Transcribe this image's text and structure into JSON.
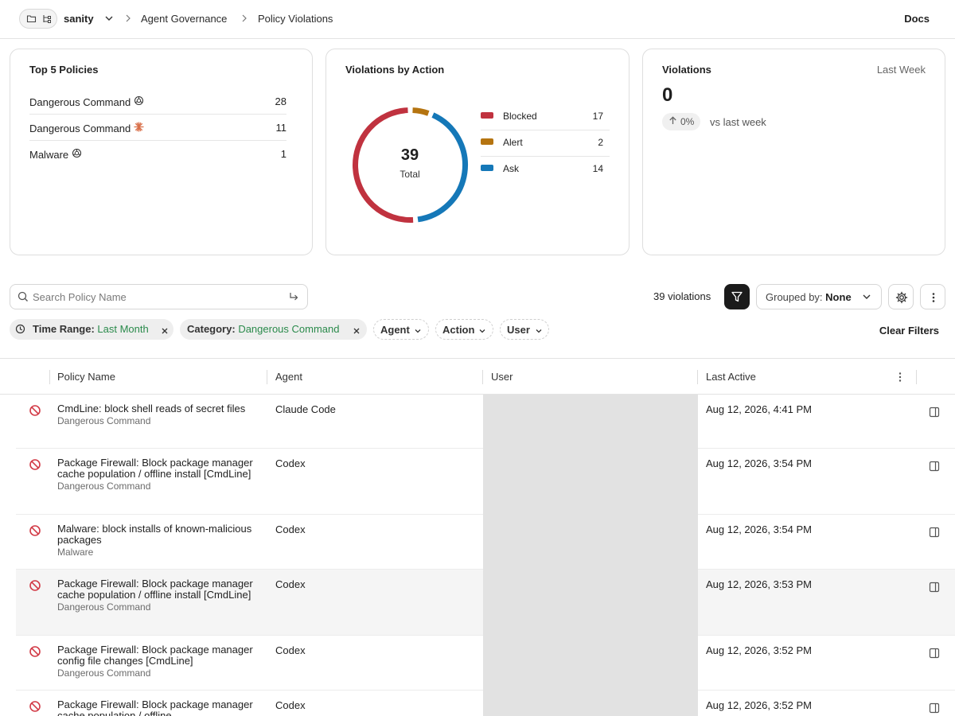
{
  "header": {
    "workspace": "sanity",
    "breadcrumbs": [
      "Agent Governance",
      "Policy Violations"
    ],
    "docs_label": "Docs"
  },
  "top_policies": {
    "title": "Top 5 Policies",
    "items": [
      {
        "name": "Dangerous Command",
        "count": "28",
        "icon": "openai-logo-icon"
      },
      {
        "name": "Dangerous Command",
        "count": "11",
        "icon": "claude-logo-icon"
      },
      {
        "name": "Malware",
        "count": "1",
        "icon": "openai-logo-icon"
      }
    ]
  },
  "violations_by_action": {
    "title": "Violations by Action",
    "total": "39",
    "total_label": "Total",
    "items": [
      {
        "label": "Blocked",
        "value": "17",
        "color": "#c0323f"
      },
      {
        "label": "Alert",
        "value": "2",
        "color": "#b57410"
      },
      {
        "label": "Ask",
        "value": "14",
        "color": "#1578b8"
      }
    ]
  },
  "violations_kpi": {
    "title": "Violations",
    "period": "Last Week",
    "value": "0",
    "delta": "0%",
    "delta_label": "vs last week"
  },
  "toolbar": {
    "search_placeholder": "Search Policy Name",
    "count_label": "39 violations",
    "grouped_prefix": "Grouped by:",
    "grouped_value": "None"
  },
  "filters": {
    "time_range_label": "Time Range:",
    "time_range_value": "Last Month",
    "category_label": "Category:",
    "category_value": "Dangerous Command",
    "agent": "Agent",
    "action": "Action",
    "user": "User",
    "clear": "Clear Filters"
  },
  "table": {
    "columns": [
      "Policy Name",
      "Agent",
      "User",
      "Last Active"
    ],
    "rows": [
      {
        "name": "CmdLine: block shell reads of secret files",
        "category": "Dangerous Command",
        "agent": "Claude Code",
        "last_active": "Aug 12, 2026, 4:41 PM"
      },
      {
        "name": "Package Firewall: Block package manager cache population / offline install [CmdLine]",
        "category": "Dangerous Command",
        "agent": "Codex",
        "last_active": "Aug 12, 2026, 3:54 PM"
      },
      {
        "name": "Malware: block installs of known-malicious packages",
        "category": "Malware",
        "agent": "Codex",
        "last_active": "Aug 12, 2026, 3:54 PM"
      },
      {
        "name": "Package Firewall: Block package manager cache population / offline install [CmdLine]",
        "category": "Dangerous Command",
        "agent": "Codex",
        "last_active": "Aug 12, 2026, 3:53 PM"
      },
      {
        "name": "Package Firewall: Block package manager config file changes [CmdLine]",
        "category": "Dangerous Command",
        "agent": "Codex",
        "last_active": "Aug 12, 2026, 3:52 PM"
      },
      {
        "name": "Package Firewall: Block package manager cache population / offline",
        "category": "",
        "agent": "Codex",
        "last_active": "Aug 12, 2026, 3:52 PM"
      }
    ]
  }
}
